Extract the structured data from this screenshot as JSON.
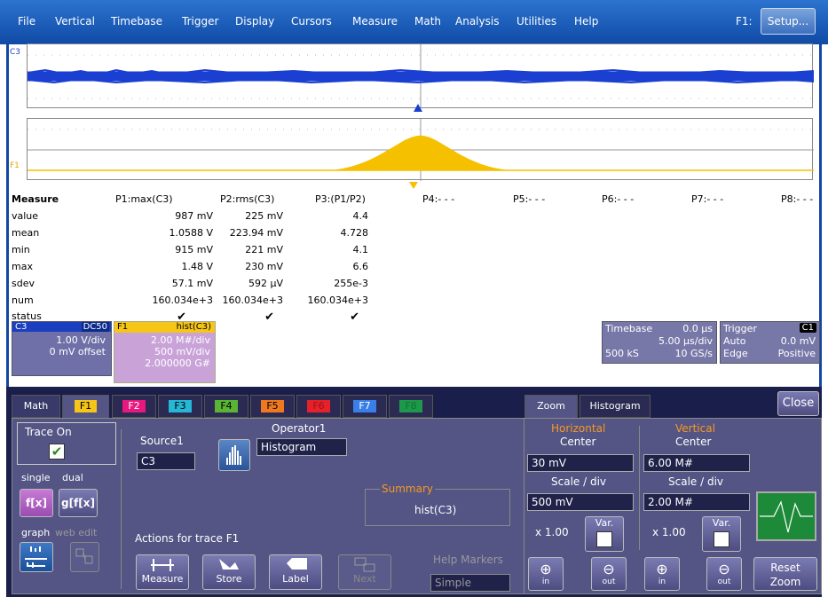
{
  "menu": {
    "items": [
      "File",
      "Vertical",
      "Timebase",
      "Trigger",
      "Display",
      "Cursors",
      "Measure",
      "Math",
      "Analysis",
      "Utilities",
      "Help"
    ],
    "fn_label": "F1:",
    "setup_label": "Setup..."
  },
  "traces": {
    "c3_label": "C3",
    "f1_label": "F1",
    "colors": {
      "c3": "#1a3fd1",
      "f1": "#f5c000"
    }
  },
  "measure": {
    "header": "Measure",
    "params": [
      "P1:max(C3)",
      "P2:rms(C3)",
      "P3:(P1/P2)",
      "P4:- - -",
      "P5:- - -",
      "P6:- - -",
      "P7:- - -",
      "P8:- - -"
    ],
    "rows": [
      {
        "label": "value",
        "v": [
          "987 mV",
          "225 mV",
          "4.4"
        ]
      },
      {
        "label": "mean",
        "v": [
          "1.0588 V",
          "223.94 mV",
          "4.728"
        ]
      },
      {
        "label": "min",
        "v": [
          "915 mV",
          "221 mV",
          "4.1"
        ]
      },
      {
        "label": "max",
        "v": [
          "1.48 V",
          "230 mV",
          "6.6"
        ]
      },
      {
        "label": "sdev",
        "v": [
          "57.1 mV",
          "592 µV",
          "255e-3"
        ]
      },
      {
        "label": "num",
        "v": [
          "160.034e+3",
          "160.034e+3",
          "160.034e+3"
        ]
      },
      {
        "label": "status",
        "v": [
          "✔",
          "✔",
          "✔"
        ]
      }
    ]
  },
  "tiles": {
    "c3": {
      "name": "C3",
      "coupling": "DC50",
      "vdiv": "1.00 V/div",
      "offset": "0 mV offset"
    },
    "f1": {
      "name": "F1",
      "func": "hist(C3)",
      "l1": "2.00 M#/div",
      "l2": "500 mV/div",
      "l3": "2.000000 G#"
    },
    "timebase": {
      "title": "Timebase",
      "delay": "0.0 µs",
      "rate": "5.00 µs/div",
      "samples": "500 kS",
      "srate": "10 GS/s"
    },
    "trigger": {
      "title": "Trigger",
      "src": "C1",
      "mode": "Auto",
      "level": "0.0 mV",
      "type": "Edge",
      "slope": "Positive"
    }
  },
  "panel": {
    "tabs": [
      "Math",
      "F1",
      "F2",
      "F3",
      "F4",
      "F5",
      "F6",
      "F7",
      "F8"
    ],
    "tab_colors": [
      "#f5c518",
      "#e8197e",
      "#26b6d6",
      "#5ab535",
      "#f0781e",
      "#e52129",
      "#3a7fe8",
      "#1c9a4a"
    ],
    "trace_on": "Trace On",
    "single": "single",
    "dual": "dual",
    "single_btn": "f[x]",
    "dual_btn": "g[f[x]",
    "graph": "graph",
    "web_edit": "web edit",
    "source_label": "Source1",
    "source_value": "C3",
    "operator_label": "Operator1",
    "operator_value": "Histogram",
    "summary_label": "Summary",
    "summary_value": "hist(C3)",
    "actions_label": "Actions for trace F1",
    "actions": [
      "Measure",
      "Store",
      "Label",
      "Next"
    ],
    "help_markers": "Help Markers",
    "help_value": "Simple"
  },
  "zoom": {
    "tabs": [
      "Zoom",
      "Histogram"
    ],
    "close": "Close",
    "horizontal": "Horizontal",
    "vertical": "Vertical",
    "center": "Center",
    "scale": "Scale / div",
    "h_center": "30 mV",
    "v_center": "6.00 M#",
    "h_scale": "500 mV",
    "v_scale": "2.00 M#",
    "h_mult": "x 1.00",
    "v_mult": "x 1.00",
    "var": "Var.",
    "in": "in",
    "out": "out",
    "reset": "Reset Zoom"
  }
}
